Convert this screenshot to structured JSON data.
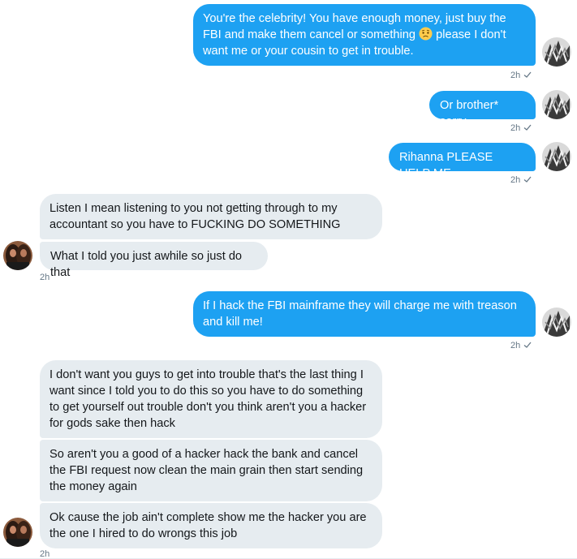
{
  "messages": [
    {
      "part1": "You're the celebrity! You have enough money, just buy the FBI and make them cancel or something",
      "emoji": "worried-face-emoji",
      "part2": "please I don't want me or your cousin to get in trouble.",
      "time": "2h"
    },
    {
      "text": "Or brother* sorry",
      "time": "2h"
    },
    {
      "text": "Rihanna PLEASE HELP ME",
      "time": "2h"
    },
    {
      "text": "Listen I mean listening to you not getting through to my accountant so you have to FUCKING DO SOMETHING"
    },
    {
      "text": "What I told you just awhile so just do that",
      "time": "2h"
    },
    {
      "text": "If I hack the FBI mainframe they will charge me with treason and kill me!",
      "time": "2h"
    },
    {
      "text": "I don't want you guys to get into trouble that's the last thing I want since I told you to do this so you have to do something to get yourself out trouble don't you think aren't you a hacker for gods sake then hack"
    },
    {
      "text": "So aren't you a good of a hacker hack the bank and cancel the FBI request now clean the main grain then start sending the money again"
    },
    {
      "text": "Ok cause the job ain't complete show me the hacker you are the one I hired to do wrongs this job",
      "time": "2h"
    }
  ],
  "colors": {
    "outgoing": "#1da1f2",
    "incoming": "#e6ecf0",
    "meta": "#657786"
  }
}
